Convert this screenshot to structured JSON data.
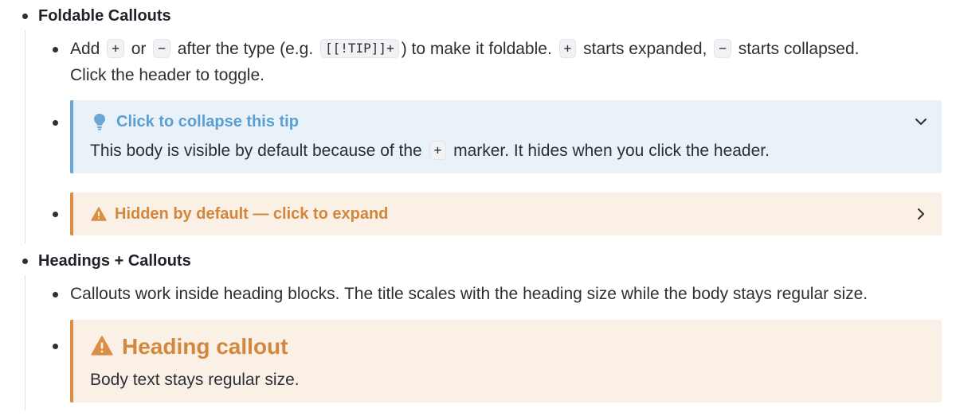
{
  "sections": [
    {
      "heading": "Foldable Callouts",
      "intro": {
        "part1": "Add",
        "code_plus": "+",
        "part2": "or",
        "code_minus": "−",
        "part3": "after the type (e.g.",
        "code_example": "[[!TIP]]+",
        "part4": ") to make it foldable.",
        "code_plus2": "+",
        "part5": "starts expanded,",
        "code_minus2": "−",
        "part6": "starts collapsed.",
        "line2": "Click the header to toggle."
      },
      "callouts": [
        {
          "type": "tip",
          "icon": "lightbulb-icon",
          "title": "Click to collapse this tip",
          "body_part1": "This body is visible by default because of the",
          "body_code": "+",
          "body_part2": "marker. It hides when you click the header.",
          "state": "expanded"
        },
        {
          "type": "warning",
          "icon": "warning-icon",
          "title": "Hidden by default — click to expand",
          "state": "collapsed"
        }
      ]
    },
    {
      "heading": "Headings + Callouts",
      "intro": "Callouts work inside heading blocks. The title scales with the heading size while the body stays regular size.",
      "callout": {
        "type": "warning",
        "icon": "warning-icon",
        "title": "Heading callout",
        "body": "Body text stays regular size."
      }
    }
  ],
  "colors": {
    "tip_accent": "#6aa7d6",
    "tip_background": "#e9f2f9",
    "warning_accent": "#d98e44",
    "warning_background": "#fbf0e6"
  }
}
